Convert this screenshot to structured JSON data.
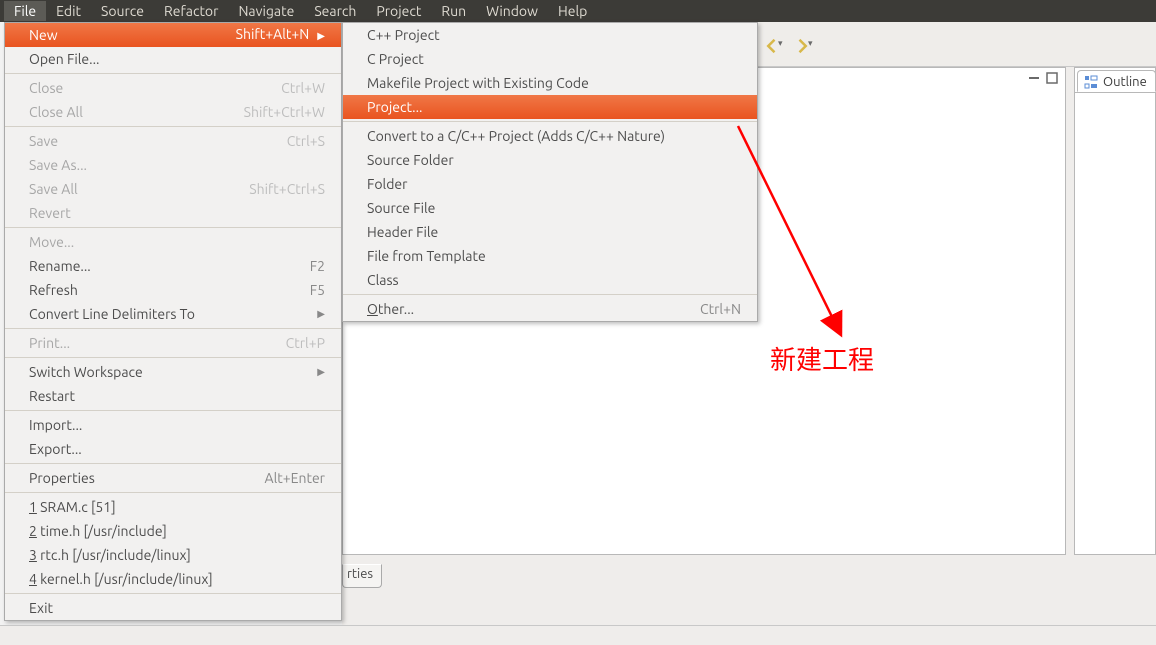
{
  "menubar": {
    "items": [
      {
        "label": "File",
        "selected": true
      },
      {
        "label": "Edit"
      },
      {
        "label": "Source"
      },
      {
        "label": "Refactor"
      },
      {
        "label": "Navigate"
      },
      {
        "label": "Search"
      },
      {
        "label": "Project"
      },
      {
        "label": "Run"
      },
      {
        "label": "Window"
      },
      {
        "label": "Help"
      }
    ]
  },
  "file_menu": {
    "new": {
      "label": "New",
      "shortcut": "Shift+Alt+N"
    },
    "open_file": {
      "label": "Open File..."
    },
    "close": {
      "label": "Close",
      "shortcut": "Ctrl+W"
    },
    "close_all": {
      "label": "Close All",
      "shortcut": "Shift+Ctrl+W"
    },
    "save": {
      "label": "Save",
      "shortcut": "Ctrl+S"
    },
    "save_as": {
      "label": "Save As..."
    },
    "save_all": {
      "label": "Save All",
      "shortcut": "Shift+Ctrl+S"
    },
    "revert": {
      "label": "Revert"
    },
    "move": {
      "label": "Move..."
    },
    "rename": {
      "label": "Rename...",
      "shortcut": "F2"
    },
    "refresh": {
      "label": "Refresh",
      "shortcut": "F5"
    },
    "convert_delim": {
      "label": "Convert Line Delimiters To"
    },
    "print": {
      "label": "Print...",
      "shortcut": "Ctrl+P"
    },
    "switch_ws": {
      "label": "Switch Workspace"
    },
    "restart": {
      "label": "Restart"
    },
    "import": {
      "label": "Import..."
    },
    "export": {
      "label": "Export..."
    },
    "properties": {
      "label": "Properties",
      "shortcut": "Alt+Enter"
    },
    "recent": [
      {
        "num": "1",
        "label": "SRAM.c  [51]"
      },
      {
        "num": "2",
        "label": "time.h  [/usr/include]"
      },
      {
        "num": "3",
        "label": "rtc.h  [/usr/include/linux]"
      },
      {
        "num": "4",
        "label": "kernel.h  [/usr/include/linux]"
      }
    ],
    "exit": {
      "label": "Exit"
    }
  },
  "new_submenu": {
    "cpp_project": {
      "label": "C++ Project"
    },
    "c_project": {
      "label": "C Project"
    },
    "makefile_project": {
      "label": "Makefile Project with Existing Code"
    },
    "project": {
      "label": "Project..."
    },
    "convert": {
      "label": "Convert to a C/C++ Project (Adds C/C++ Nature)"
    },
    "source_folder": {
      "label": "Source Folder"
    },
    "folder": {
      "label": "Folder"
    },
    "source_file": {
      "label": "Source File"
    },
    "header_file": {
      "label": "Header File"
    },
    "file_template": {
      "label": "File from Template"
    },
    "klass": {
      "label": "Class"
    },
    "other_label_prefix": "O",
    "other_label_rest": "ther...",
    "other_shortcut": "Ctrl+N"
  },
  "outline": {
    "tab_label": "Outline"
  },
  "bottom": {
    "tab_fragment": "rties"
  },
  "annotation": {
    "text": "新建工程"
  }
}
